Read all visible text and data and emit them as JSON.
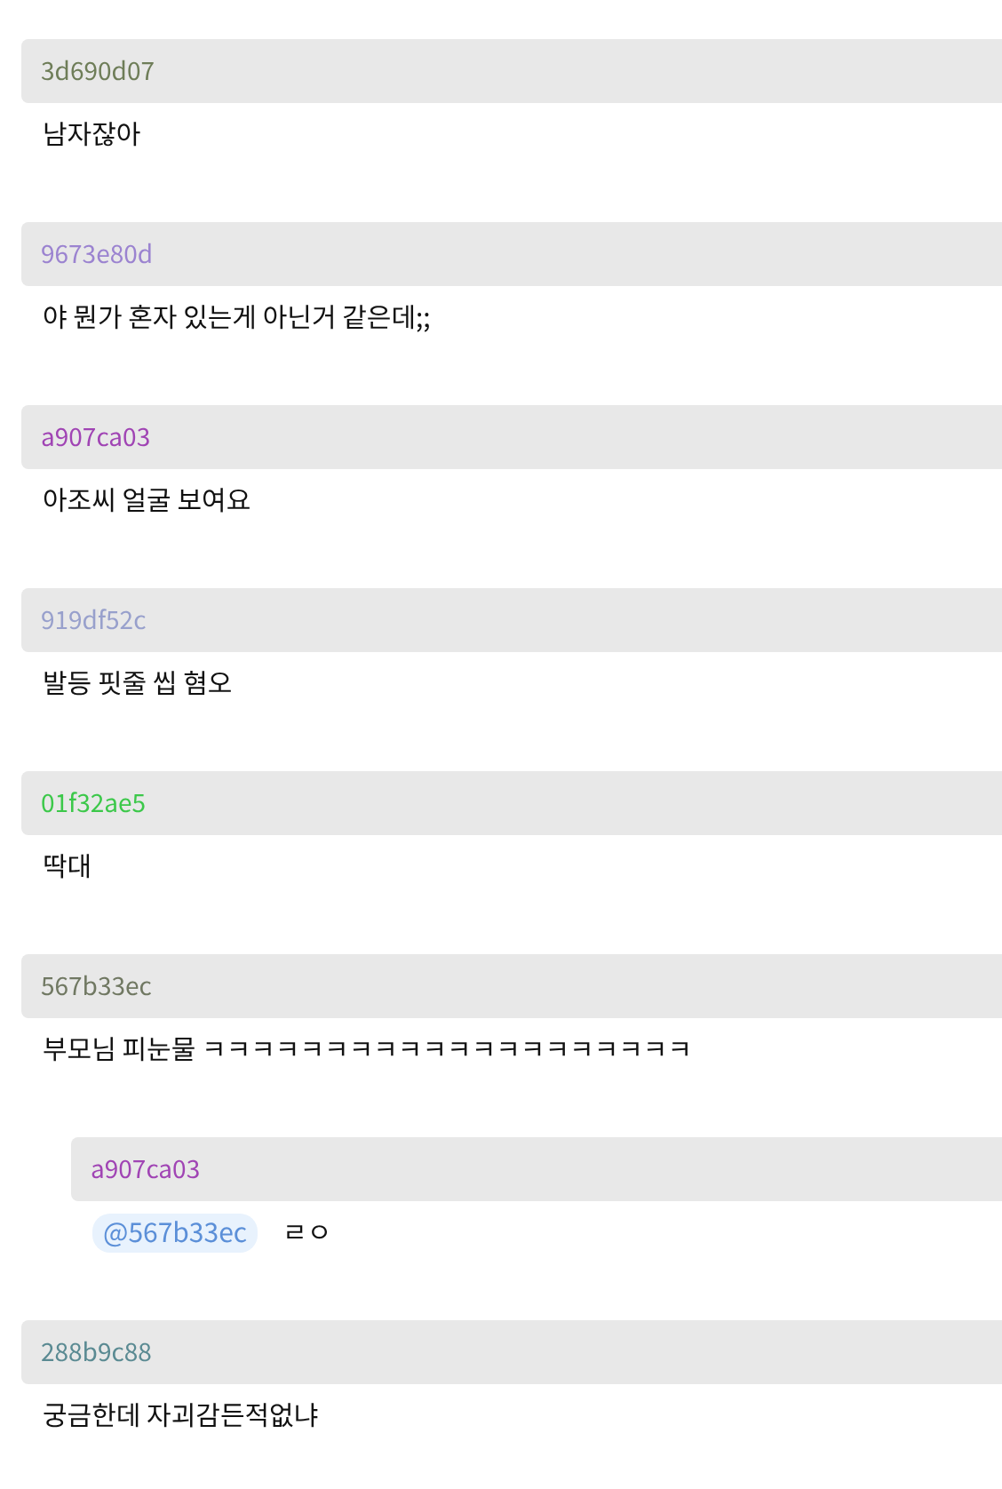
{
  "comments": [
    {
      "author": "3d690d07",
      "color": "#6e7d58",
      "text": "남자잖아"
    },
    {
      "author": "9673e80d",
      "color": "#9b83d0",
      "text": "야 뭔가 혼자 있는게 아닌거 같은데;;"
    },
    {
      "author": "a907ca03",
      "color": "#a044b4",
      "text": "아조씨 얼굴 보여요"
    },
    {
      "author": "919df52c",
      "color": "#98a0cc",
      "text": "발등 핏줄 씹 혐오"
    },
    {
      "author": "01f32ae5",
      "color": "#3cc84a",
      "text": "딱대"
    },
    {
      "author": "567b33ec",
      "color": "#707862",
      "text": "부모님 피눈물 ㅋㅋㅋㅋㅋㅋㅋㅋㅋㅋㅋㅋㅋㅋㅋㅋㅋㅋㅋㅋ",
      "replies": [
        {
          "author": "a907ca03",
          "color": "#a044b4",
          "mention": "@567b33ec",
          "text": "ㄹㅇ"
        }
      ]
    },
    {
      "author": "288b9c88",
      "color": "#5a8a92",
      "text": "궁금한데 자괴감든적없냐"
    }
  ]
}
